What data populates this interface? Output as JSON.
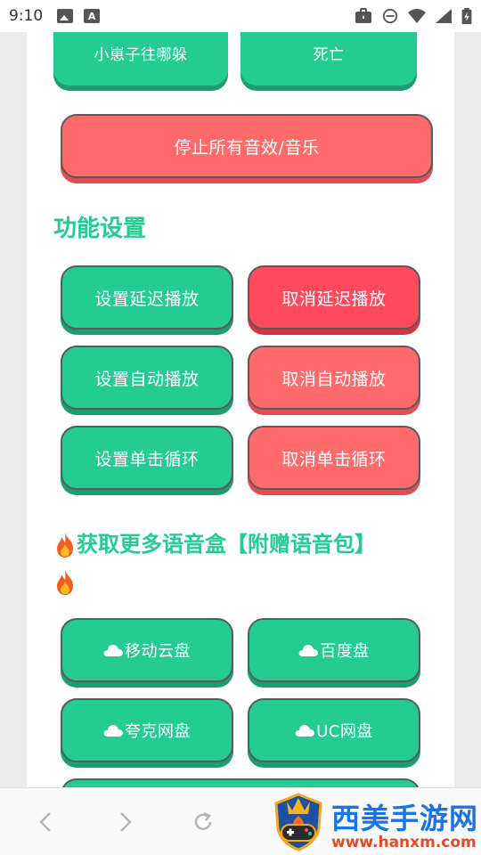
{
  "status_bar": {
    "time": "9:10",
    "left_icons": [
      "image-icon",
      "a-icon"
    ],
    "right_icons": [
      "briefcase-icon",
      "dnd-icon",
      "wifi-icon",
      "signal-icon",
      "battery-icon"
    ]
  },
  "top_buttons": [
    {
      "label": "小崽子往哪躲"
    },
    {
      "label": "死亡"
    }
  ],
  "stop_button": {
    "label": "停止所有音效/音乐"
  },
  "settings": {
    "title": "功能设置",
    "buttons": [
      {
        "label": "设置延迟播放"
      },
      {
        "label": "取消延迟播放"
      },
      {
        "label": "设置自动播放"
      },
      {
        "label": "取消自动播放"
      },
      {
        "label": "设置单击循环"
      },
      {
        "label": "取消单击循环"
      }
    ]
  },
  "more": {
    "title": "获取更多语音盒【附赠语音包】",
    "buttons": [
      {
        "label": "移动云盘"
      },
      {
        "label": "百度盘"
      },
      {
        "label": "夸克网盘"
      },
      {
        "label": "UC网盘"
      }
    ]
  },
  "colors": {
    "green": "#25cc92",
    "red": "#ff6b6b",
    "red_strong": "#ff4a5e"
  },
  "watermark": {
    "text": "西美手游网",
    "url": "www.hanxm.com"
  }
}
